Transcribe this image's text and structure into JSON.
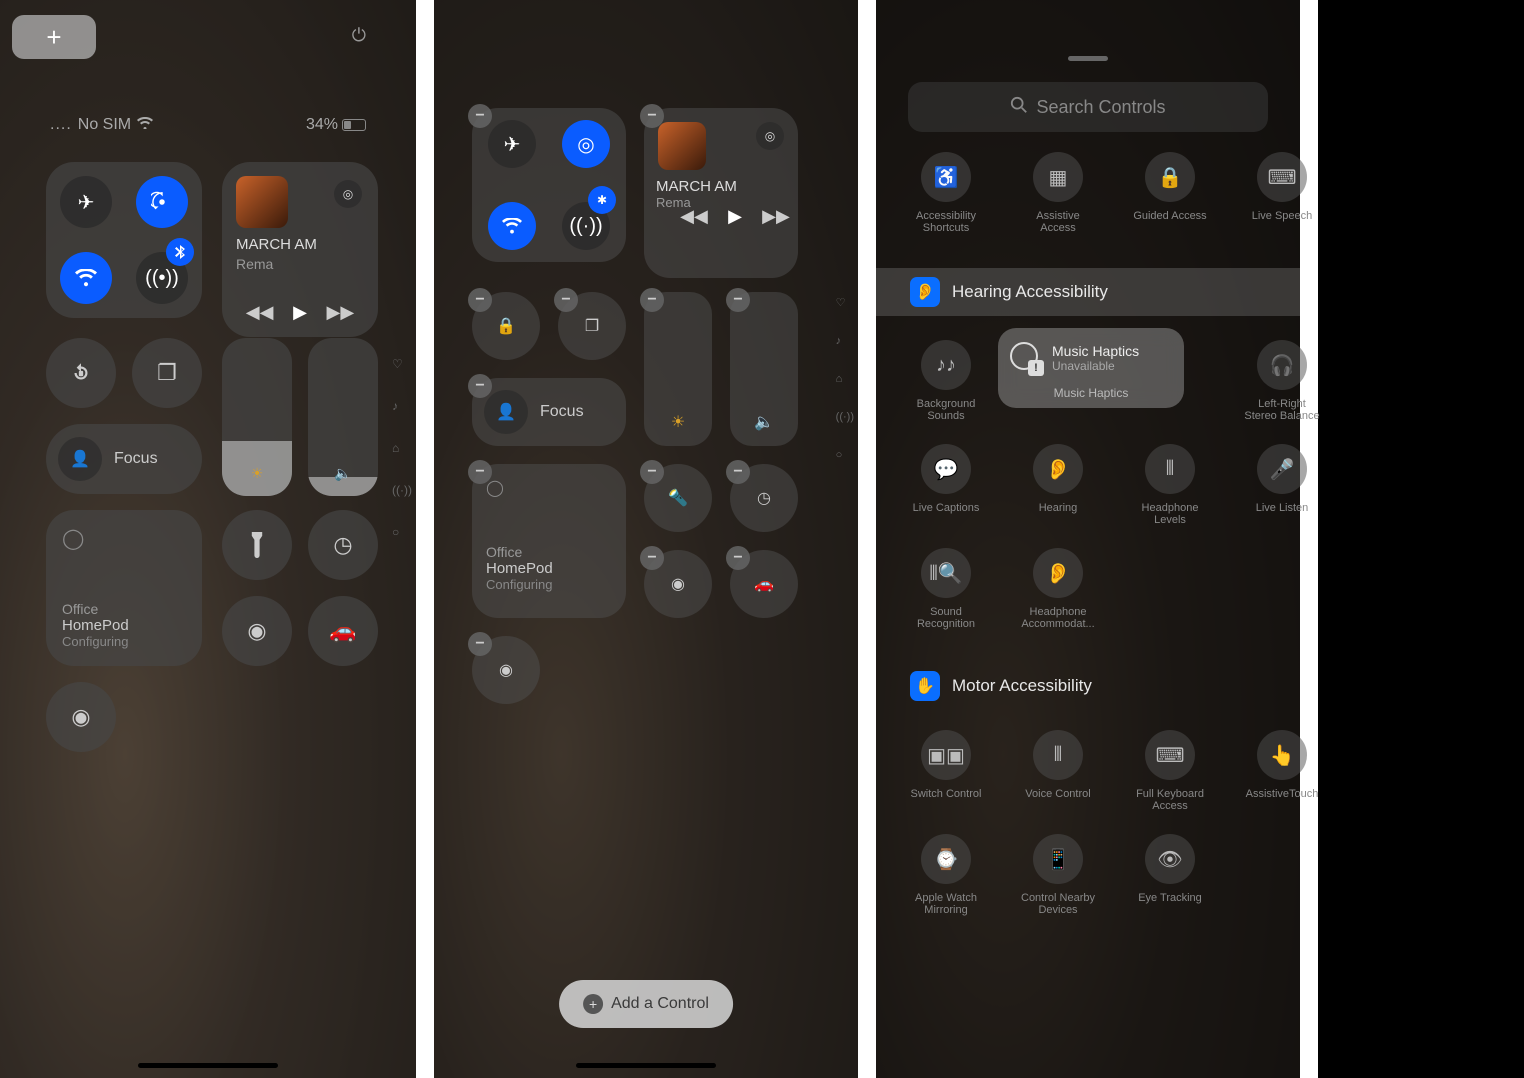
{
  "panel1": {
    "status": {
      "carrier": "No SIM",
      "battery_pct": "34%"
    },
    "media": {
      "track": "MARCH AM",
      "artist": "Rema"
    },
    "focus_label": "Focus",
    "homepod": {
      "location": "Office",
      "name": "HomePod",
      "status": "Configuring"
    }
  },
  "panel2": {
    "media": {
      "track": "MARCH AM",
      "artist": "Rema"
    },
    "focus_label": "Focus",
    "homepod": {
      "location": "Office",
      "name": "HomePod",
      "status": "Configuring"
    },
    "add_control": "Add a Control"
  },
  "panel3": {
    "search_placeholder": "Search Controls",
    "row1": [
      "Accessibility Shortcuts",
      "Assistive Access",
      "Guided Access",
      "Live Speech"
    ],
    "hearing_header": "Hearing Accessibility",
    "hearing_row1": [
      "Background Sounds",
      "",
      "Left-Right Stereo Balance"
    ],
    "hearing_row2": [
      "Live Captions",
      "Hearing",
      "Headphone Levels",
      "Live Listen"
    ],
    "hearing_row3": [
      "Sound Recognition",
      "Headphone Accommodat..."
    ],
    "motor_header": "Motor Accessibility",
    "motor_row1": [
      "Switch Control",
      "Voice Control",
      "Full Keyboard Access",
      "AssistiveTouch"
    ],
    "motor_row2": [
      "Apple Watch Mirroring",
      "Control Nearby Devices",
      "Eye Tracking"
    ],
    "popup": {
      "title": "Music Haptics",
      "sub": "Unavailable",
      "label": "Music Haptics"
    }
  }
}
